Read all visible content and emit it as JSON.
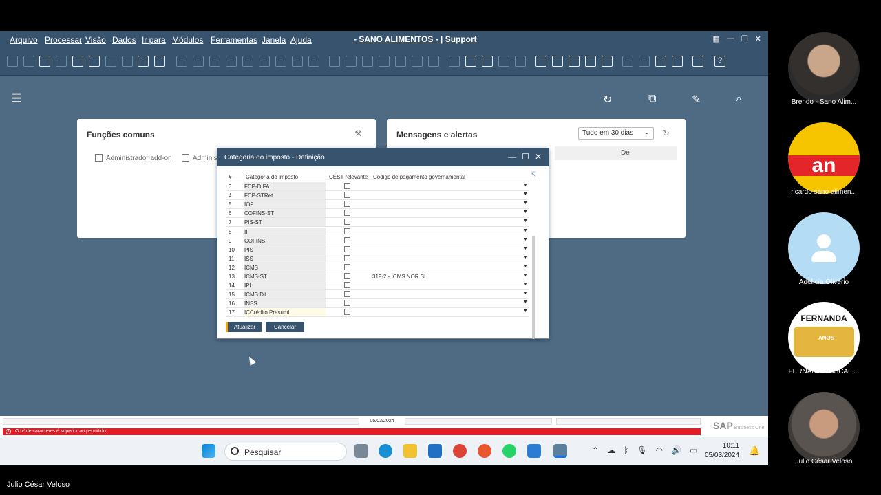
{
  "menu": [
    "Arquivo",
    "Processar",
    "Visão",
    "Dados",
    "Ir para",
    "Módulos",
    "Ferramentas",
    "Janela",
    "Ajuda"
  ],
  "app_title": "- SANO ALIMENTOS - | Support",
  "cockpit": {
    "card1_title": "Funções comuns",
    "addon1": "Administrador add-on",
    "addon2": "Adminis",
    "card2_title": "Mensagens e alertas",
    "period": "Tudo em 30 dias",
    "col_de": "De"
  },
  "dialog": {
    "title": "Categoria do imposto - Definição",
    "headers": {
      "num": "#",
      "cat": "Categoria do imposto",
      "cest": "CEST relevante",
      "code": "Código de pagamento governamental"
    },
    "rows": [
      {
        "n": "3",
        "cat": "FCP-DIFAL",
        "code": ""
      },
      {
        "n": "4",
        "cat": "FCP-STRet",
        "code": ""
      },
      {
        "n": "5",
        "cat": "IOF",
        "code": ""
      },
      {
        "n": "6",
        "cat": "COFINS-ST",
        "code": ""
      },
      {
        "n": "7",
        "cat": "PIS-ST",
        "code": ""
      },
      {
        "n": "8",
        "cat": "II",
        "code": ""
      },
      {
        "n": "9",
        "cat": "COFINS",
        "code": ""
      },
      {
        "n": "10",
        "cat": "PIS",
        "code": ""
      },
      {
        "n": "11",
        "cat": "ISS",
        "code": ""
      },
      {
        "n": "12",
        "cat": "ICMS",
        "code": ""
      },
      {
        "n": "13",
        "cat": "ICMS-ST",
        "code": "319-2 - ICMS NOR SL"
      },
      {
        "n": "14",
        "cat": "IPI",
        "code": ""
      },
      {
        "n": "15",
        "cat": "ICMS Dif",
        "code": ""
      },
      {
        "n": "16",
        "cat": "INSS",
        "code": ""
      },
      {
        "n": "17",
        "cat": "ICCrédito Presumi",
        "code": ""
      }
    ],
    "btn_update": "Atualizar",
    "btn_cancel": "Cancelar"
  },
  "status": {
    "date": "05/03/2024",
    "error": "O nº de caracteres é superior ao permitido",
    "logo_main": "SAP",
    "logo_sub": "Business One"
  },
  "taskbar": {
    "search": "Pesquisar",
    "time": "10:11",
    "date": "05/03/2024"
  },
  "participants": [
    {
      "name": "Brendo - Sano Alim..."
    },
    {
      "name": "ricardo sano alimen..."
    },
    {
      "name": "Adelícia  Olivério"
    },
    {
      "name": "FERNANDA FISCAL ...",
      "logo_text": "FERNANDA",
      "anos": "ANOS"
    },
    {
      "name": "Julio César Veloso"
    }
  ],
  "owner_name": "Julio César Veloso",
  "colors": {
    "sap_dark": "#37536e",
    "sap_bg": "#4f6b84",
    "error_red": "#e61c24",
    "accent_gold": "#f0a500"
  }
}
